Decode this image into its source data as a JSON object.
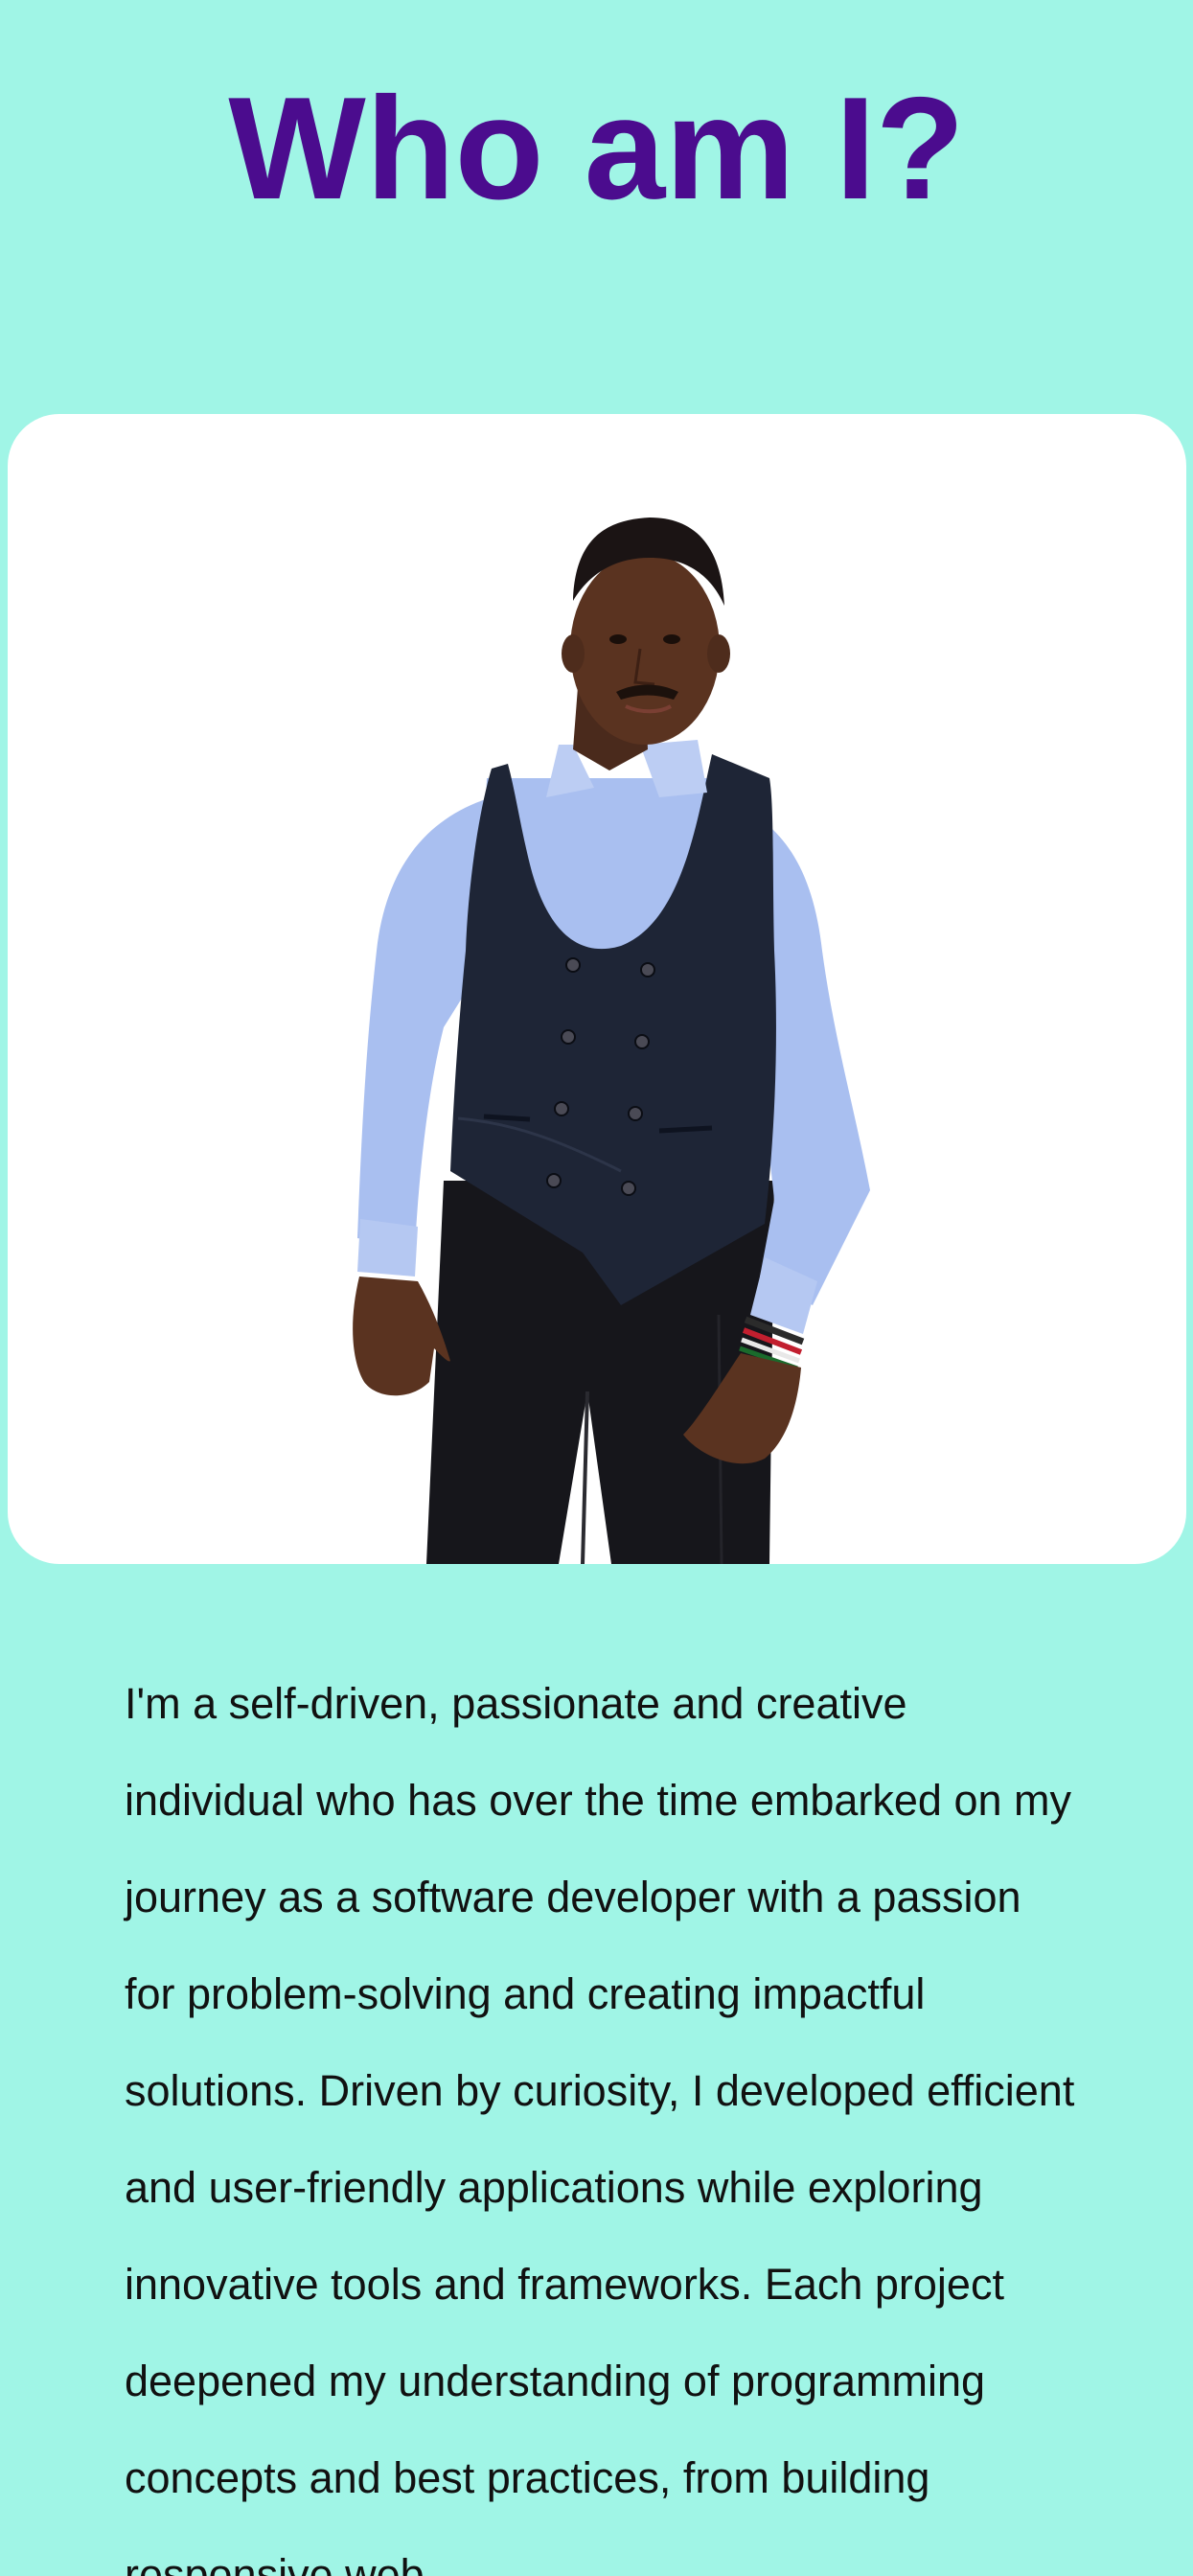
{
  "header": {
    "title": "Who am I?"
  },
  "profile_photo": {
    "alt": "Portrait of a man in a light blue shirt, dark double-breasted waistcoat and black trousers"
  },
  "about": {
    "paragraph": "I'm a self-driven, passionate and creative individual who has over the time embarked on my journey as a software developer with a passion for problem-solving and creating impactful solutions. Driven by curiosity, I developed efficient and user-friendly applications while exploring innovative tools and frameworks. Each project deepened my understanding of programming concepts and best practices, from building responsive web"
  },
  "colors": {
    "background": "#a0f5e6",
    "title": "#4b0c8e",
    "card": "#ffffff",
    "text": "#111111"
  }
}
